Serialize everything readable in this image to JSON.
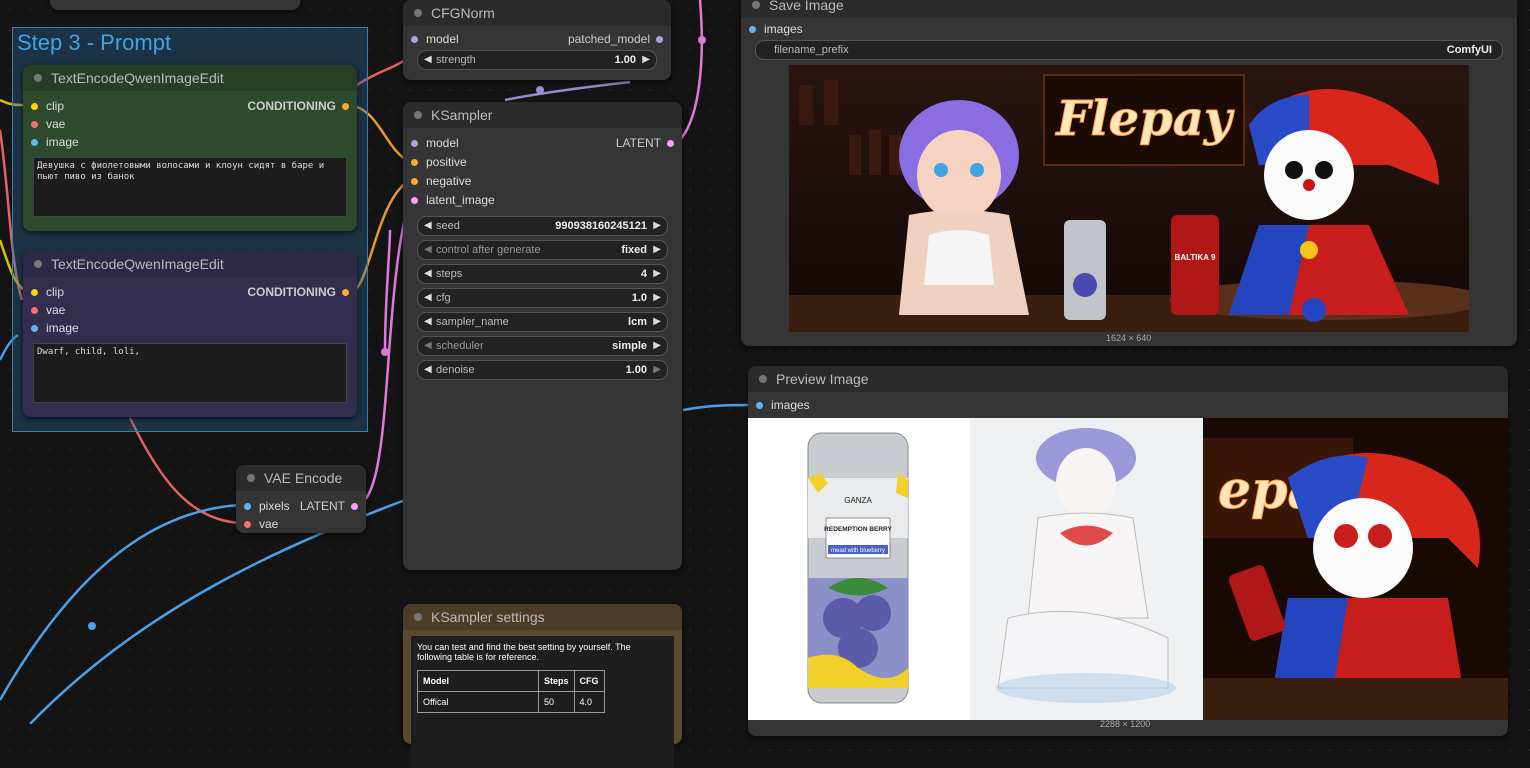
{
  "group": {
    "title": "Step 3 - Prompt"
  },
  "nodes": {
    "cfgnorm": {
      "title": "CFGNorm",
      "in_model": "model",
      "out_patched": "patched_model",
      "strength_label": "strength",
      "strength_value": "1.00"
    },
    "ksampler": {
      "title": "KSampler",
      "in_model": "model",
      "in_positive": "positive",
      "in_negative": "negative",
      "in_latent": "latent_image",
      "out_latent": "LATENT",
      "widgets": [
        {
          "name": "seed",
          "value": "990938160245121"
        },
        {
          "name": "control after generate",
          "value": "fixed"
        },
        {
          "name": "steps",
          "value": "4"
        },
        {
          "name": "cfg",
          "value": "1.0"
        },
        {
          "name": "sampler_name",
          "value": "lcm"
        },
        {
          "name": "scheduler",
          "value": "simple"
        },
        {
          "name": "denoise",
          "value": "1.00"
        }
      ]
    },
    "text1": {
      "title": "TextEncodeQwenImageEdit",
      "in_clip": "clip",
      "in_vae": "vae",
      "in_image": "image",
      "out_cond": "CONDITIONING",
      "prompt": "Девушка с фиолетовыми волосами и клоун сидят в баре и пьют пиво из банок"
    },
    "text2": {
      "title": "TextEncodeQwenImageEdit",
      "in_clip": "clip",
      "in_vae": "vae",
      "in_image": "image",
      "out_cond": "CONDITIONING",
      "prompt": "Dwarf, child, loli,"
    },
    "vae_encode": {
      "title": "VAE Encode",
      "in_pixels": "pixels",
      "in_vae": "vae",
      "out_latent": "LATENT"
    },
    "save_image": {
      "title": "Save Image",
      "in_images": "images",
      "prefix_label": "filename_prefix",
      "prefix_value": "ComfyUI",
      "dims": "1624 × 640",
      "neon_text": "Flepay",
      "can_text": "BALTIKA 9"
    },
    "preview_image": {
      "title": "Preview Image",
      "in_images": "images",
      "dims": "2288 × 1200",
      "can_brand": "GANZA",
      "can_name": "REDEMPTION BERRY",
      "can_sub": "mead with blueberry",
      "neon_text": "epay"
    },
    "settings": {
      "title": "KSampler settings",
      "desc": "You can test and find the best setting by yourself. The following table is for reference.",
      "table_headers": [
        "Model",
        "Steps",
        "CFG"
      ],
      "table_rows": [
        [
          "Offical",
          "50",
          "4.0"
        ]
      ]
    }
  },
  "colors": {
    "model": "#b39ddb",
    "clip": "#ffd500",
    "vae": "#ff6e6e",
    "image": "#64b5f6",
    "conditioning": "#ffa931",
    "latent": "#ff9cf9"
  }
}
